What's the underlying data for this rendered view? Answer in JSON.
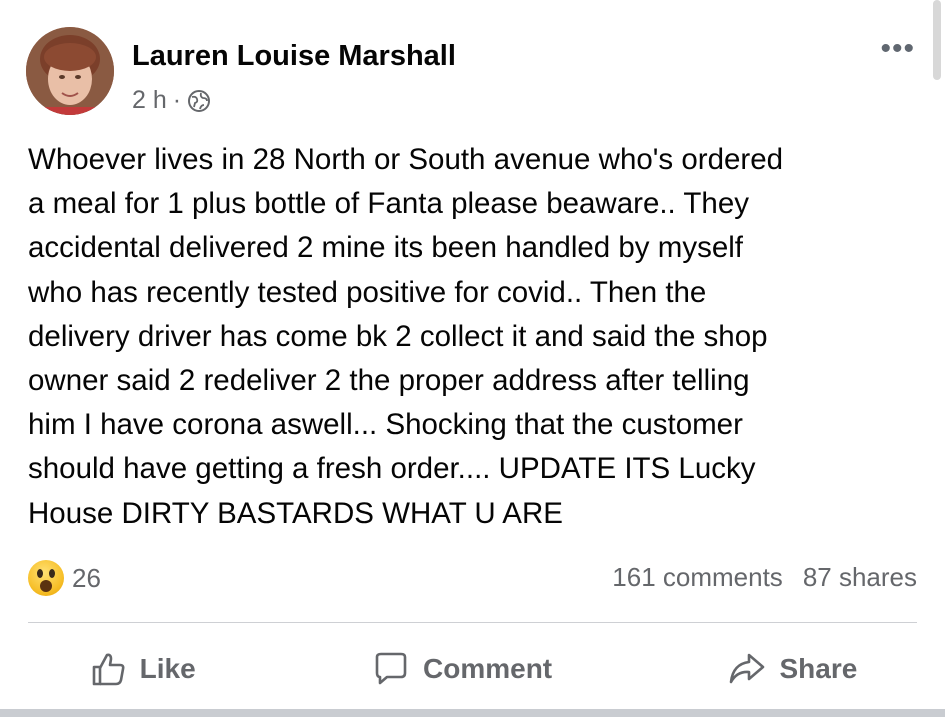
{
  "post": {
    "author": "Lauren Louise Marshall",
    "time": "2 h",
    "separator": "·",
    "privacy_icon": "globe-icon",
    "more_icon": "more-options-icon",
    "more_glyph": "•••",
    "body": "Whoever lives in 28 North or South avenue who's ordered\na meal for 1 plus bottle of Fanta please beaware.. They\naccidental delivered 2 mine its been handled by myself\nwho has recently tested positive for covid.. Then the\ndelivery driver has come bk 2 collect it and said the shop\nowner said 2 redeliver 2 the proper address after telling\nhim I have corona aswell... Shocking that the customer\nshould have getting a fresh order.... UPDATE ITS Lucky\nHouse DIRTY BASTARDS WHAT U ARE"
  },
  "engagement": {
    "reaction_icon": "wow-reaction-icon",
    "reaction_count": "26",
    "comments": "161 comments",
    "shares": "87 shares"
  },
  "actions": {
    "like": "Like",
    "comment": "Comment",
    "share": "Share"
  },
  "colors": {
    "text": "#050505",
    "secondary": "#65676b",
    "divider": "#ced0d4"
  }
}
